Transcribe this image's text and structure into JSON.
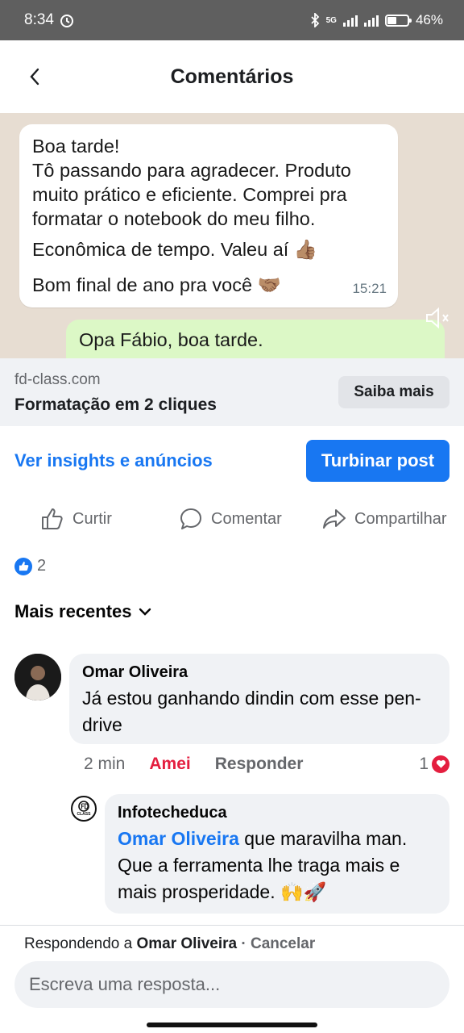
{
  "status_bar": {
    "time": "8:34",
    "alarm_icon": "alarm-icon",
    "network": "5G",
    "battery": "46%",
    "battery_level": 0.46
  },
  "header": {
    "title": "Comentários",
    "back_icon": "chevron-left-icon"
  },
  "post_media": {
    "greeting": "Boa tarde!",
    "message_lines": [
      "Tô passando para agradecer. Produto",
      "muito prático e eficiente. Comprei pra",
      "formatar o notebook do meu filho."
    ],
    "line2": "Econômica de tempo. Valeu aí 👍🏽",
    "line3": "Bom final de ano pra você 🤝🏽",
    "time": "15:21",
    "reply_preview": "Opa Fábio, boa tarde."
  },
  "link_preview": {
    "domain": "fd-class.com",
    "title": "Formatação em 2 cliques",
    "cta": "Saiba mais"
  },
  "promo": {
    "insights": "Ver insights e anúncios",
    "boost": "Turbinar post"
  },
  "actions": {
    "like": "Curtir",
    "comment": "Comentar",
    "share": "Compartilhar"
  },
  "reactions": {
    "count": "2"
  },
  "sort": {
    "label": "Mais recentes"
  },
  "comments": [
    {
      "author": "Omar Oliveira",
      "text": "Já estou ganhando dindin com esse pen-drive",
      "time": "2 min",
      "reaction_label": "Amei",
      "reply_label": "Responder",
      "reaction_count": "1"
    }
  ],
  "reply": {
    "author": "Infotecheduca",
    "avatar_text": "CLASS",
    "mention": "Omar Oliveira",
    "text": " que maravilha man. Que a ferramenta lhe traga mais e mais prosperidade. 🙌🚀"
  },
  "composer": {
    "replying_prefix": "Respondendo a ",
    "replying_to": "Omar Oliveira",
    "separator": " · ",
    "cancel": "Cancelar",
    "placeholder": "Escreva uma resposta..."
  },
  "colors": {
    "accent": "#1877f2",
    "love": "#e41e3f",
    "status_bar": "#5f5f5f",
    "chat_bg": "#e7ddd2",
    "chat_reply": "#dcf8c6"
  }
}
